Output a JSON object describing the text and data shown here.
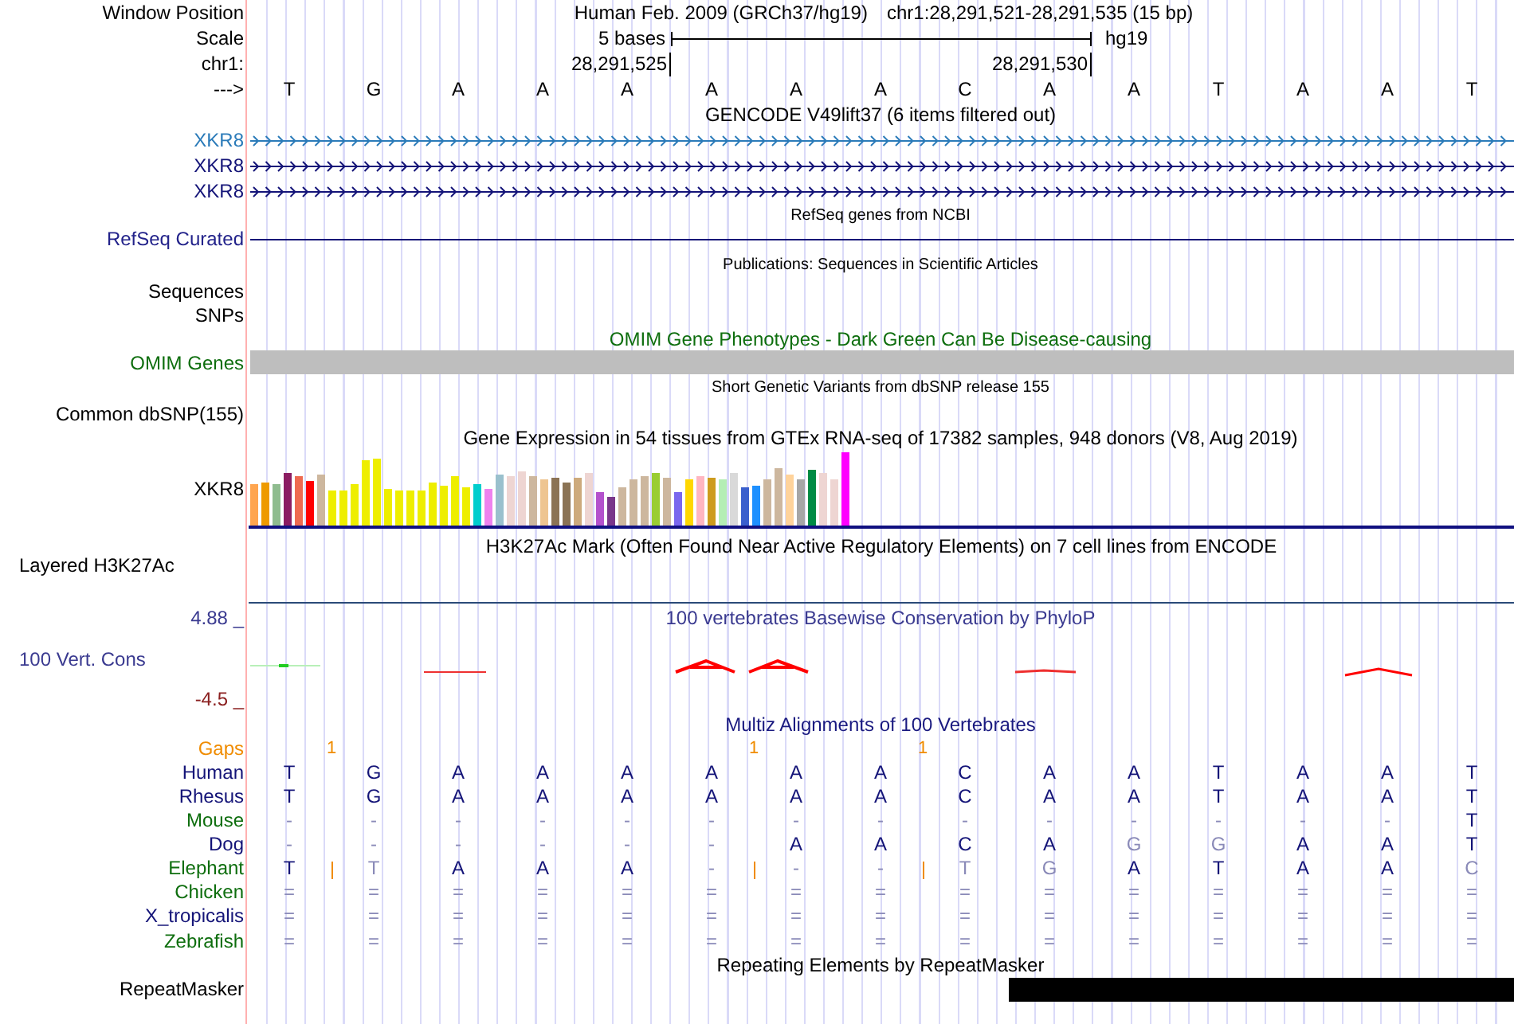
{
  "header": {
    "label": "Window Position",
    "assembly": "Human Feb. 2009 (GRCh37/hg19)",
    "position": "chr1:28,291,521-28,291,535 (15 bp)"
  },
  "scale": {
    "label": "Scale",
    "span": "5 bases",
    "assembly": "hg19"
  },
  "coordinates": {
    "label": "chr1:",
    "ticks": [
      "28,291,525",
      "28,291,530"
    ]
  },
  "sequence": {
    "label": "--->",
    "bases": [
      "T",
      "G",
      "A",
      "A",
      "A",
      "A",
      "A",
      "A",
      "C",
      "A",
      "A",
      "T",
      "A",
      "A",
      "T"
    ]
  },
  "tracks": [
    {
      "kind": "genes",
      "title": "GENCODE V49lift37 (6 items filtered out)",
      "items": [
        {
          "label": "XKR8",
          "color": "#2b7bb9"
        },
        {
          "label": "XKR8",
          "color": "#141478"
        },
        {
          "label": "XKR8",
          "color": "#141478"
        }
      ]
    },
    {
      "kind": "refseq",
      "title": "RefSeq genes from NCBI",
      "label": "RefSeq Curated"
    },
    {
      "kind": "empty",
      "title": "Publications: Sequences in Scientific Articles",
      "labels": [
        "Sequences",
        "SNPs"
      ]
    },
    {
      "kind": "omim",
      "title": "OMIM Gene Phenotypes - Dark Green Can Be Disease-causing",
      "label": "OMIM Genes"
    },
    {
      "kind": "empty",
      "title": "Short Genetic Variants from dbSNP release 155",
      "labels": [
        "Common dbSNP(155)"
      ]
    },
    {
      "kind": "expression",
      "title": "Gene Expression in 54 tissues from GTEx RNA-seq of 17382 samples, 948 donors (V8, Aug 2019)",
      "label": "XKR8"
    },
    {
      "kind": "h3k27ac",
      "title": "H3K27Ac Mark (Often Found Near Active Regulatory Elements) on 7 cell lines from ENCODE",
      "label": "Layered H3K27Ac"
    },
    {
      "kind": "conservation",
      "title": "100 vertebrates Basewise Conservation by PhyloP",
      "label": "100 Vert. Cons",
      "max": "4.88 _",
      "min": "-4.5 _"
    },
    {
      "kind": "multiz",
      "title": "Multiz Alignments of 100 Vertebrates",
      "gaps": {
        "label": "Gaps",
        "color": "#f08c00",
        "counts": [
          "1",
          "1",
          "1"
        ]
      },
      "species": [
        {
          "label": "Human",
          "color": "#141478",
          "cells": [
            {
              "text": "T",
              "faded": false
            },
            {
              "text": "G",
              "faded": false
            },
            {
              "text": "A",
              "faded": false
            },
            {
              "text": "A",
              "faded": false
            },
            {
              "text": "A",
              "faded": false
            },
            {
              "text": "A",
              "faded": false
            },
            {
              "text": "A",
              "faded": false
            },
            {
              "text": "A",
              "faded": false
            },
            {
              "text": "C",
              "faded": false
            },
            {
              "text": "A",
              "faded": false
            },
            {
              "text": "A",
              "faded": false
            },
            {
              "text": "T",
              "faded": false
            },
            {
              "text": "A",
              "faded": false
            },
            {
              "text": "A",
              "faded": false
            },
            {
              "text": "T",
              "faded": false
            }
          ]
        },
        {
          "label": "Rhesus",
          "color": "#141478",
          "cells": [
            {
              "text": "T",
              "faded": false
            },
            {
              "text": "G",
              "faded": false
            },
            {
              "text": "A",
              "faded": false
            },
            {
              "text": "A",
              "faded": false
            },
            {
              "text": "A",
              "faded": false
            },
            {
              "text": "A",
              "faded": false
            },
            {
              "text": "A",
              "faded": false
            },
            {
              "text": "A",
              "faded": false
            },
            {
              "text": "C",
              "faded": false
            },
            {
              "text": "A",
              "faded": false
            },
            {
              "text": "A",
              "faded": false
            },
            {
              "text": "T",
              "faded": false
            },
            {
              "text": "A",
              "faded": false
            },
            {
              "text": "A",
              "faded": false
            },
            {
              "text": "T",
              "faded": false
            }
          ]
        },
        {
          "label": "Mouse",
          "color": "#0e6e0e",
          "cells": [
            {
              "text": "-",
              "faded": true
            },
            {
              "text": "-",
              "faded": true
            },
            {
              "text": "-",
              "faded": true
            },
            {
              "text": "-",
              "faded": true
            },
            {
              "text": "-",
              "faded": true
            },
            {
              "text": "-",
              "faded": true
            },
            {
              "text": "-",
              "faded": true
            },
            {
              "text": "-",
              "faded": true
            },
            {
              "text": "-",
              "faded": true
            },
            {
              "text": "-",
              "faded": true
            },
            {
              "text": "-",
              "faded": true
            },
            {
              "text": "-",
              "faded": true
            },
            {
              "text": "-",
              "faded": true
            },
            {
              "text": "-",
              "faded": true
            },
            {
              "text": "T",
              "faded": false
            }
          ]
        },
        {
          "label": "Dog",
          "color": "#141478",
          "cells": [
            {
              "text": "-",
              "faded": true
            },
            {
              "text": "-",
              "faded": true
            },
            {
              "text": "-",
              "faded": true
            },
            {
              "text": "-",
              "faded": true
            },
            {
              "text": "-",
              "faded": true
            },
            {
              "text": "-",
              "faded": true
            },
            {
              "text": "A",
              "faded": false
            },
            {
              "text": "A",
              "faded": false
            },
            {
              "text": "C",
              "faded": false
            },
            {
              "text": "A",
              "faded": false
            },
            {
              "text": "G",
              "faded": true
            },
            {
              "text": "G",
              "faded": true
            },
            {
              "text": "A",
              "faded": false
            },
            {
              "text": "A",
              "faded": false
            },
            {
              "text": "T",
              "faded": false
            }
          ]
        },
        {
          "label": "Elephant",
          "color": "#0e6e0e",
          "cells": [
            {
              "text": "T",
              "faded": false,
              "insertion": true
            },
            {
              "text": "T",
              "faded": true,
              "insertion": false
            },
            {
              "text": "A",
              "faded": false,
              "insertion": false
            },
            {
              "text": "A",
              "faded": false,
              "insertion": false
            },
            {
              "text": "A",
              "faded": false,
              "insertion": false
            },
            {
              "text": "-",
              "faded": true,
              "insertion": true
            },
            {
              "text": "-",
              "faded": true,
              "insertion": false
            },
            {
              "text": "-",
              "faded": true,
              "insertion": true
            },
            {
              "text": "T",
              "faded": true,
              "insertion": false
            },
            {
              "text": "G",
              "faded": true,
              "insertion": false
            },
            {
              "text": "A",
              "faded": false,
              "insertion": false
            },
            {
              "text": "T",
              "faded": false,
              "insertion": false
            },
            {
              "text": "A",
              "faded": false,
              "insertion": false
            },
            {
              "text": "A",
              "faded": false,
              "insertion": false
            },
            {
              "text": "C",
              "faded": true,
              "insertion": false
            }
          ]
        },
        {
          "label": "Chicken",
          "color": "#0e6e0e",
          "cells": [
            {
              "text": "=",
              "faded": true
            },
            {
              "text": "=",
              "faded": true
            },
            {
              "text": "=",
              "faded": true
            },
            {
              "text": "=",
              "faded": true
            },
            {
              "text": "=",
              "faded": true
            },
            {
              "text": "=",
              "faded": true
            },
            {
              "text": "=",
              "faded": true
            },
            {
              "text": "=",
              "faded": true
            },
            {
              "text": "=",
              "faded": true
            },
            {
              "text": "=",
              "faded": true
            },
            {
              "text": "=",
              "faded": true
            },
            {
              "text": "=",
              "faded": true
            },
            {
              "text": "=",
              "faded": true
            },
            {
              "text": "=",
              "faded": true
            },
            {
              "text": "=",
              "faded": true
            }
          ]
        },
        {
          "label": "X_tropicalis",
          "color": "#141478",
          "cells": [
            {
              "text": "=",
              "faded": true
            },
            {
              "text": "=",
              "faded": true
            },
            {
              "text": "=",
              "faded": true
            },
            {
              "text": "=",
              "faded": true
            },
            {
              "text": "=",
              "faded": true
            },
            {
              "text": "=",
              "faded": true
            },
            {
              "text": "=",
              "faded": true
            },
            {
              "text": "=",
              "faded": true
            },
            {
              "text": "=",
              "faded": true
            },
            {
              "text": "=",
              "faded": true
            },
            {
              "text": "=",
              "faded": true
            },
            {
              "text": "=",
              "faded": true
            },
            {
              "text": "=",
              "faded": true
            },
            {
              "text": "=",
              "faded": true
            },
            {
              "text": "=",
              "faded": true
            }
          ]
        },
        {
          "label": "Zebrafish",
          "color": "#0e6e0e",
          "cells": [
            {
              "text": "=",
              "faded": true
            },
            {
              "text": "=",
              "faded": true
            },
            {
              "text": "=",
              "faded": true
            },
            {
              "text": "=",
              "faded": true
            },
            {
              "text": "=",
              "faded": true
            },
            {
              "text": "=",
              "faded": true
            },
            {
              "text": "=",
              "faded": true
            },
            {
              "text": "=",
              "faded": true
            },
            {
              "text": "=",
              "faded": true
            },
            {
              "text": "=",
              "faded": true
            },
            {
              "text": "=",
              "faded": true
            },
            {
              "text": "=",
              "faded": true
            },
            {
              "text": "=",
              "faded": true
            },
            {
              "text": "=",
              "faded": true
            },
            {
              "text": "=",
              "faded": true
            }
          ]
        }
      ]
    },
    {
      "kind": "repeats",
      "title": "Repeating Elements by RepeatMasker",
      "label": "RepeatMasker"
    }
  ]
}
